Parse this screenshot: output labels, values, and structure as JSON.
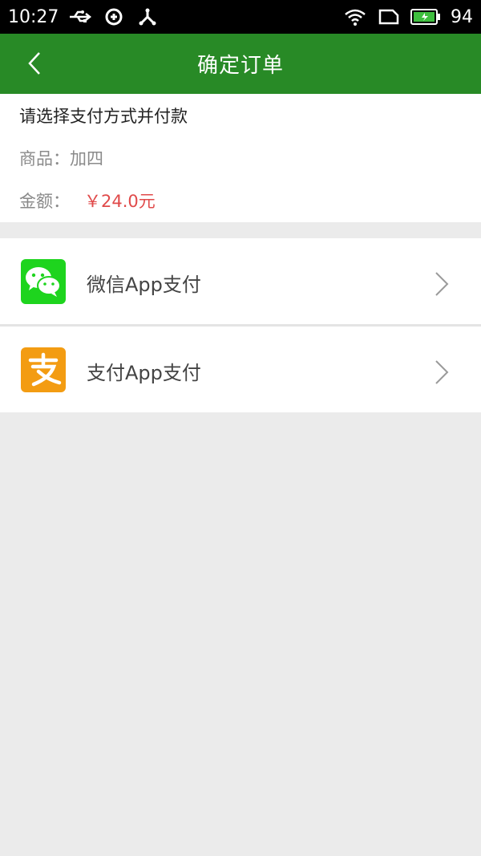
{
  "status_bar": {
    "time": "10:27",
    "battery": "94"
  },
  "header": {
    "title": "确定订单"
  },
  "order": {
    "prompt": "请选择支付方式并付款",
    "goods_label": "商品：",
    "goods_value": "加四",
    "amount_label": "金额：",
    "amount_value": "￥24.0元"
  },
  "payment_methods": [
    {
      "label": "微信App支付",
      "icon": "wechat-icon",
      "color": "#1ed41e"
    },
    {
      "label": "支付App支付",
      "icon": "alipay-icon",
      "color": "#f39c12"
    }
  ],
  "colors": {
    "header": "#288a26",
    "amount": "#e04a4a"
  }
}
